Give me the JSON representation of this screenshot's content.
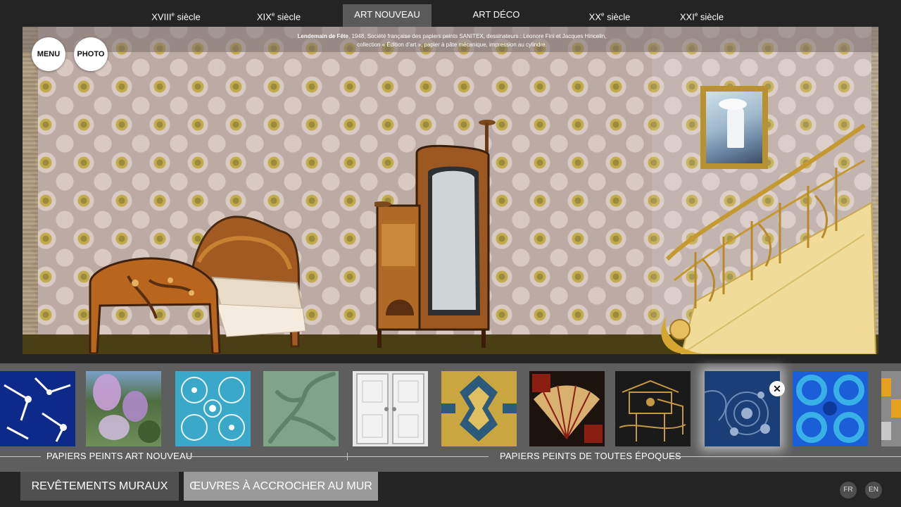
{
  "nav": {
    "items": [
      {
        "main": "XVIII",
        "sup": "e",
        "rest": " siècle"
      },
      {
        "main": "XIX",
        "sup": "e",
        "rest": " siècle"
      },
      {
        "main": "ART NOUVEAU",
        "sup": "",
        "rest": ""
      },
      {
        "main": "ART DÉCO",
        "sup": "",
        "rest": ""
      },
      {
        "main": "XX",
        "sup": "e",
        "rest": " siècle"
      },
      {
        "main": "XXI",
        "sup": "e",
        "rest": " siècle"
      }
    ],
    "active_index": 2
  },
  "scene": {
    "caption_title": "Lendemain de Fête",
    "caption_line1": ", 1948, Société française des papiers peints SANITEX, dessinateurs : Léonore Fini et Jacques Hincelin,",
    "caption_line2": "collection « Édition d'art », papier à pâte mécanique, impression au cylindre.",
    "menu_label": "MENU",
    "photo_label": "PHOTO"
  },
  "strip": {
    "thumbnails": [
      {
        "icon": "skeleton-pattern",
        "colors": [
          "#0d2a8a",
          "#ffffff"
        ]
      },
      {
        "icon": "wisteria-landscape",
        "colors": [
          "#6e8f5a",
          "#c9a9d8"
        ]
      },
      {
        "icon": "lace-pattern",
        "colors": [
          "#3aa8c8",
          "#e8f4f8"
        ]
      },
      {
        "icon": "green-branch-pattern",
        "colors": [
          "#7fa488",
          "#5d8468"
        ]
      },
      {
        "icon": "white-panel-door",
        "colors": [
          "#e8e8e8",
          "#bdbdbd"
        ]
      },
      {
        "icon": "art-deco-ornament",
        "colors": [
          "#c9a640",
          "#2b5a7a"
        ]
      },
      {
        "icon": "oriental-fan-pattern",
        "colors": [
          "#8a1e10",
          "#d8b070"
        ]
      },
      {
        "icon": "chinoiserie-pattern",
        "colors": [
          "#1a1a1a",
          "#c49a40"
        ]
      },
      {
        "icon": "blue-floral-pattern",
        "colors": [
          "#1c3e76",
          "#6a8ab8"
        ]
      },
      {
        "icon": "blue-circles-pattern",
        "colors": [
          "#1a5fd8",
          "#39b0e6"
        ]
      },
      {
        "icon": "geometric-pattern",
        "colors": [
          "#e6a020",
          "#8a8a8a"
        ]
      }
    ],
    "selected_index": 8,
    "close_label": "✕",
    "section_left": "PAPIERS PEINTS ART NOUVEAU",
    "section_right": "PAPIERS PEINTS DE TOUTES ÉPOQUES"
  },
  "bottom": {
    "tab_left": "REVÊTEMENTS MURAUX",
    "tab_right": "ŒUVRES À ACCROCHER AU MUR",
    "lang_fr": "FR",
    "lang_en": "EN"
  }
}
